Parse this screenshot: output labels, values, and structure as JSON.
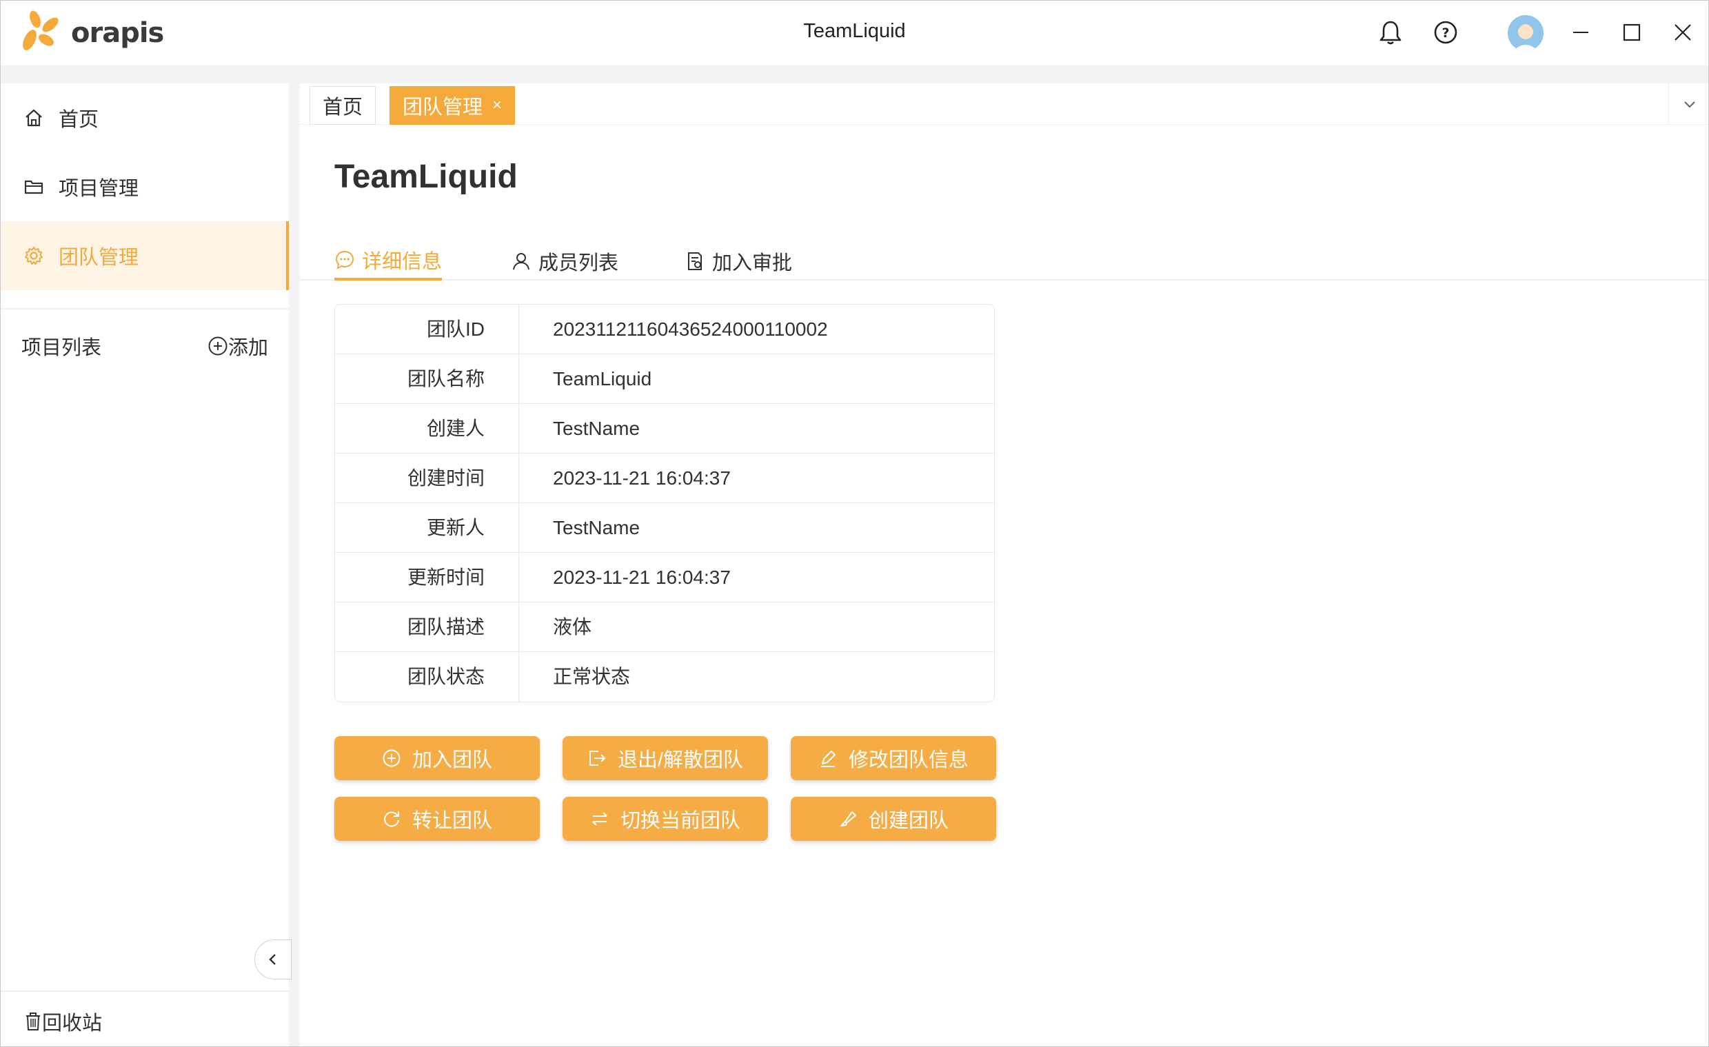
{
  "app": {
    "logo_text": "orapis",
    "window_title": "TeamLiquid",
    "icons": [
      "bell-icon",
      "help-icon",
      "avatar",
      "minimize-icon",
      "maximize-icon",
      "close-icon"
    ]
  },
  "sidebar": {
    "items": [
      {
        "label": "首页",
        "icon": "home-icon"
      },
      {
        "label": "项目管理",
        "icon": "folder-icon"
      },
      {
        "label": "团队管理",
        "icon": "gear-icon",
        "active": true
      }
    ],
    "project_list_title": "项目列表",
    "add_label": "添加",
    "recycle_label": "回收站"
  },
  "page_tabs": [
    {
      "label": "首页"
    },
    {
      "label": "团队管理",
      "active": true,
      "close": "×"
    }
  ],
  "main": {
    "title": "TeamLiquid",
    "sub_tabs": [
      {
        "label": "详细信息",
        "icon": "chat-icon",
        "active": true
      },
      {
        "label": "成员列表",
        "icon": "user-icon"
      },
      {
        "label": "加入审批",
        "icon": "document-icon"
      }
    ],
    "details": [
      {
        "label": "团队ID",
        "value": "20231121160436524000110002"
      },
      {
        "label": "团队名称",
        "value": "TeamLiquid"
      },
      {
        "label": "创建人",
        "value": "TestName"
      },
      {
        "label": "创建时间",
        "value": "2023-11-21 16:04:37"
      },
      {
        "label": "更新人",
        "value": "TestName"
      },
      {
        "label": "更新时间",
        "value": "2023-11-21 16:04:37"
      },
      {
        "label": "团队描述",
        "value": "液体"
      },
      {
        "label": "团队状态",
        "value": "正常状态"
      }
    ],
    "buttons": [
      {
        "label": "加入团队",
        "icon": "plus-circle-icon"
      },
      {
        "label": "退出/解散团队",
        "icon": "exit-icon"
      },
      {
        "label": "修改团队信息",
        "icon": "edit-icon"
      },
      {
        "label": "转让团队",
        "icon": "refresh-icon"
      },
      {
        "label": "切换当前团队",
        "icon": "switch-icon"
      },
      {
        "label": "创建团队",
        "icon": "brush-icon"
      }
    ]
  },
  "colors": {
    "accent": "#f5a93a",
    "accent_bg": "#fef4e6",
    "button": "#f5ac44",
    "border": "#e4e7ed"
  }
}
